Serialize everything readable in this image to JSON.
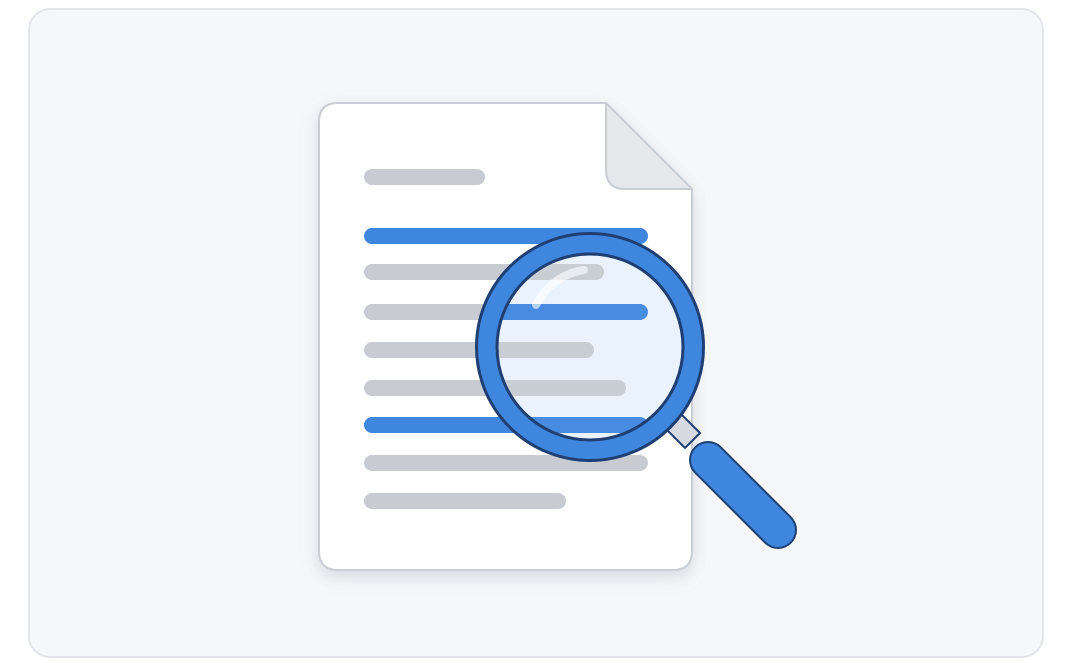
{
  "illustration": {
    "description_icon": "document-search-icon",
    "colors": {
      "card_background": "#f6f7f9",
      "card_border": "#e3e5ea",
      "page": "#ffffff",
      "page_border": "#c9cdd4",
      "fold": "#e6e8ec",
      "text_line_gray": "#c8ccd2",
      "text_line_highlight": "#3f86df",
      "magnifier_blue": "#3f86df",
      "magnifier_outline": "#1f3f73",
      "magnifier_lens": "#eaf3fd",
      "magnifier_neck": "#d7dbe1"
    }
  }
}
